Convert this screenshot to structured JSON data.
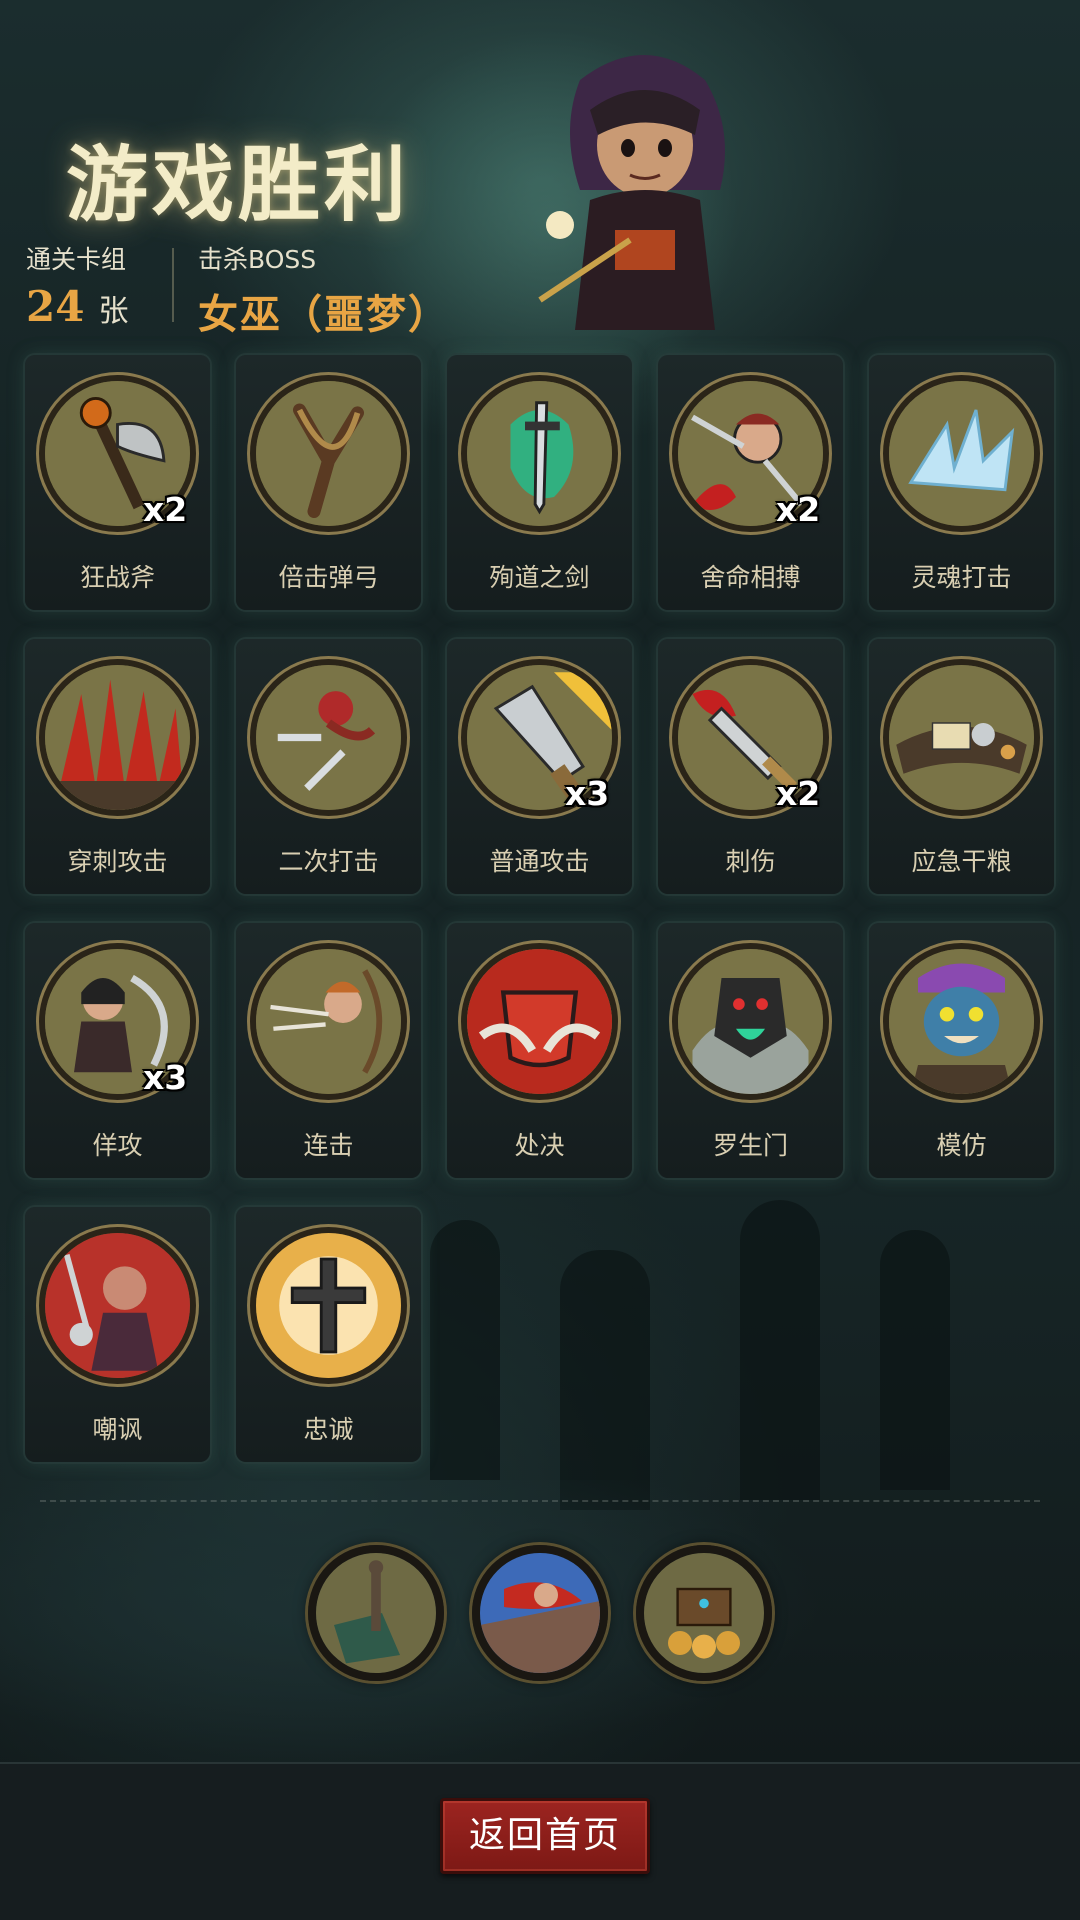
{
  "header": {
    "title": "游戏胜利",
    "deck_label": "通关卡组",
    "deck_count": "24",
    "deck_unit": "张",
    "boss_label": "击杀BOSS",
    "boss_name": "女巫（噩梦）"
  },
  "cards": [
    {
      "name": "狂战斧",
      "multiplier": "x2",
      "icon": "axe-icon"
    },
    {
      "name": "倍击弹弓",
      "multiplier": "",
      "icon": "slingshot-icon"
    },
    {
      "name": "殉道之剑",
      "multiplier": "",
      "icon": "spectral-sword-icon"
    },
    {
      "name": "舍命相搏",
      "multiplier": "x2",
      "icon": "desperate-strike-icon"
    },
    {
      "name": "灵魂打击",
      "multiplier": "",
      "icon": "ice-shard-icon"
    },
    {
      "name": "穿刺攻击",
      "multiplier": "",
      "icon": "spikes-icon"
    },
    {
      "name": "二次打击",
      "multiplier": "",
      "icon": "double-dagger-icon"
    },
    {
      "name": "普通攻击",
      "multiplier": "x3",
      "icon": "greatsword-icon"
    },
    {
      "name": "刺伤",
      "multiplier": "x2",
      "icon": "bloody-sword-icon"
    },
    {
      "name": "应急干粮",
      "multiplier": "",
      "icon": "rations-icon"
    },
    {
      "name": "佯攻",
      "multiplier": "x3",
      "icon": "feint-ninja-icon"
    },
    {
      "name": "连击",
      "multiplier": "",
      "icon": "archer-icon"
    },
    {
      "name": "处决",
      "multiplier": "",
      "icon": "execution-icon"
    },
    {
      "name": "罗生门",
      "multiplier": "",
      "icon": "demon-gate-icon"
    },
    {
      "name": "模仿",
      "multiplier": "",
      "icon": "goblin-mimic-icon"
    },
    {
      "name": "嘲讽",
      "multiplier": "",
      "icon": "taunt-icon"
    },
    {
      "name": "忠诚",
      "multiplier": "",
      "icon": "holy-cross-icon"
    }
  ],
  "rewards": [
    {
      "icon": "map-sword-icon"
    },
    {
      "icon": "hero-flag-icon"
    },
    {
      "icon": "treasure-chest-icon"
    }
  ],
  "footer": {
    "home_button": "返回首页"
  },
  "colors": {
    "accent_gold": "#e8a544",
    "title_cream": "#f3ecc8",
    "button_red": "#9c2420",
    "medal_olive": "#7a7447"
  }
}
